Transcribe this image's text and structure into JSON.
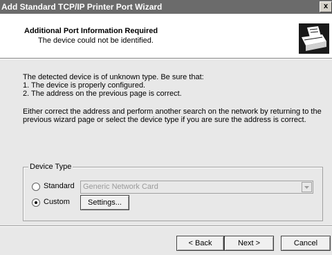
{
  "window": {
    "title": "Add Standard TCP/IP Printer Port Wizard",
    "close_label": "x"
  },
  "header": {
    "title": "Additional Port Information Required",
    "subtitle": "The device could not be identified.",
    "icon": "printer-wizard-icon"
  },
  "body": {
    "lines": [
      "The detected device is of unknown type.  Be sure that:",
      "1. The device is properly configured.",
      "2. The address on the previous page is correct."
    ],
    "instructions": [
      "Either correct the address and perform another search on the network by returning to the",
      "previous wizard page or select the device type if you are sure the address is correct."
    ]
  },
  "device_type": {
    "legend": "Device Type",
    "standard_label": "Standard",
    "standard_selected": false,
    "standard_value": "Generic Network Card",
    "custom_label": "Custom",
    "custom_selected": true,
    "settings_label": "Settings..."
  },
  "buttons": {
    "back": "< Back",
    "next": "Next >",
    "cancel": "Cancel"
  },
  "colors": {
    "titlebar": "#6b6b6b",
    "dialog_bg": "#e8e8e8",
    "header_bg": "#ffffff"
  }
}
